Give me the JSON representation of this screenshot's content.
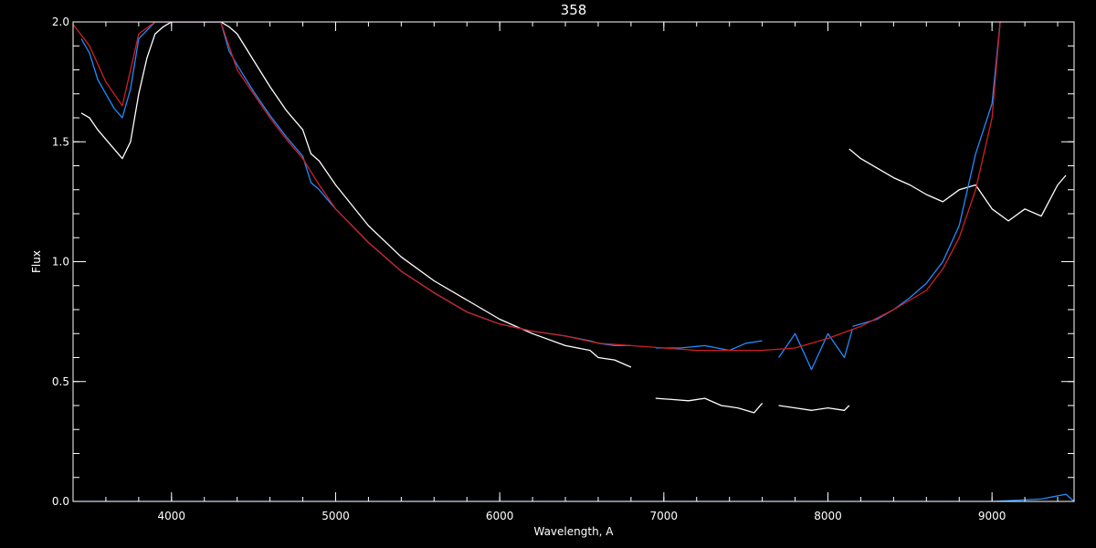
{
  "chart_data": {
    "type": "line",
    "title": "358",
    "xlabel": "Wavelength, A",
    "ylabel": "Flux",
    "xlim": [
      3400,
      9500
    ],
    "ylim": [
      0.0,
      2.0
    ],
    "x_ticks": [
      4000,
      5000,
      6000,
      7000,
      8000,
      9000
    ],
    "x_tick_labels": [
      "4000",
      "5000",
      "6000",
      "7000",
      "8000",
      "9000"
    ],
    "y_ticks": [
      0.0,
      0.5,
      1.0,
      1.5,
      2.0
    ],
    "y_tick_labels": [
      "0.0",
      "0.5",
      "1.0",
      "1.5",
      "2.0"
    ],
    "x_minor_step": 200,
    "y_minor_step": 0.1,
    "grid": false,
    "colors": {
      "background": "#000000",
      "axes": "#ffffff",
      "white_spectrum": "#ffffff",
      "blue_spectrum": "#1e8cff",
      "red_model": "#d02020"
    },
    "series": [
      {
        "color": "#ffffff",
        "segments": [
          {
            "x": [
              3450,
              3500,
              3550,
              3600,
              3650,
              3700,
              3750,
              3800,
              3850,
              3900,
              3950,
              4000,
              4100,
              4200,
              4300,
              4350,
              4400,
              4500,
              4600,
              4700,
              4800,
              4850,
              4900,
              5000,
              5200,
              5400,
              5600,
              5800,
              6000,
              6200,
              6400,
              6550,
              6600,
              6700,
              6800
            ],
            "y": [
              1.62,
              1.6,
              1.55,
              1.51,
              1.47,
              1.43,
              1.5,
              1.7,
              1.85,
              1.95,
              1.98,
              2.0,
              2.0,
              2.0,
              2.0,
              1.98,
              1.95,
              1.84,
              1.73,
              1.63,
              1.55,
              1.45,
              1.42,
              1.32,
              1.15,
              1.02,
              0.92,
              0.84,
              0.76,
              0.7,
              0.65,
              0.63,
              0.6,
              0.59,
              0.56
            ]
          },
          {
            "x": [
              6950,
              7050,
              7150,
              7250,
              7350,
              7450,
              7550,
              7600
            ],
            "y": [
              0.43,
              0.425,
              0.42,
              0.43,
              0.4,
              0.39,
              0.37,
              0.41
            ]
          },
          {
            "x": [
              7700,
              7800,
              7900,
              8000,
              8100,
              8130
            ],
            "y": [
              0.4,
              0.39,
              0.38,
              0.39,
              0.38,
              0.4
            ]
          },
          {
            "x": [
              8130,
              8200,
              8300,
              8400,
              8500,
              8600,
              8700,
              8800,
              8900,
              9000,
              9100,
              9200,
              9300,
              9400,
              9450
            ],
            "y": [
              1.47,
              1.43,
              1.39,
              1.35,
              1.32,
              1.28,
              1.25,
              1.3,
              1.32,
              1.22,
              1.17,
              1.22,
              1.19,
              1.32,
              1.36
            ]
          }
        ]
      },
      {
        "color": "#1e8cff",
        "segments": [
          {
            "x": [
              3450,
              3500,
              3550,
              3600,
              3650,
              3700,
              3750,
              3800,
              3900,
              4000,
              4100,
              4200,
              4300,
              4350,
              4400,
              4500,
              4600,
              4700,
              4800,
              4850,
              4900,
              5000,
              5200,
              5400,
              5600,
              5800,
              6000,
              6200,
              6400,
              6550,
              6600,
              6700,
              6800
            ],
            "y": [
              1.93,
              1.87,
              1.76,
              1.7,
              1.64,
              1.6,
              1.72,
              1.93,
              2.0,
              2.0,
              2.0,
              2.0,
              2.0,
              1.88,
              1.82,
              1.71,
              1.61,
              1.52,
              1.44,
              1.33,
              1.3,
              1.22,
              1.08,
              0.96,
              0.87,
              0.79,
              0.74,
              0.71,
              0.69,
              0.67,
              0.66,
              0.65,
              0.65
            ]
          },
          {
            "x": [
              6950,
              7100,
              7250,
              7400,
              7500,
              7600
            ],
            "y": [
              0.64,
              0.64,
              0.65,
              0.63,
              0.66,
              0.67
            ]
          },
          {
            "x": [
              7700,
              7800,
              7900,
              8000,
              8100,
              8150
            ],
            "y": [
              0.6,
              0.7,
              0.55,
              0.7,
              0.6,
              0.72
            ]
          },
          {
            "x": [
              8150,
              8300,
              8400,
              8500,
              8600,
              8700,
              8800,
              8850,
              8900,
              9000,
              9050
            ],
            "y": [
              0.73,
              0.76,
              0.8,
              0.85,
              0.91,
              1.0,
              1.15,
              1.3,
              1.45,
              1.66,
              2.0
            ]
          },
          {
            "x": [
              3400,
              5000,
              6000,
              7000,
              8000,
              9000,
              9300,
              9450,
              9500
            ],
            "y": [
              0.0,
              0.0,
              0.0,
              0.0,
              0.0,
              0.0,
              0.01,
              0.03,
              0.0
            ]
          }
        ]
      },
      {
        "color": "#d02020",
        "segments": [
          {
            "x": [
              3400,
              3500,
              3600,
              3700,
              3800,
              3900,
              4000,
              4100,
              4200,
              4300,
              4400,
              4500,
              4600,
              4700,
              4800,
              4900,
              5000,
              5200,
              5400,
              5600,
              5800,
              6000,
              6200,
              6400,
              6600,
              6800,
              7000,
              7200,
              7400,
              7600,
              7800,
              8000,
              8200,
              8400,
              8600,
              8700,
              8800,
              8900,
              9000,
              9050
            ],
            "y": [
              1.99,
              1.9,
              1.75,
              1.65,
              1.95,
              2.0,
              2.0,
              2.0,
              2.0,
              2.0,
              1.8,
              1.7,
              1.6,
              1.51,
              1.43,
              1.32,
              1.22,
              1.08,
              0.96,
              0.87,
              0.79,
              0.74,
              0.71,
              0.69,
              0.66,
              0.65,
              0.64,
              0.63,
              0.63,
              0.63,
              0.64,
              0.68,
              0.73,
              0.8,
              0.88,
              0.97,
              1.1,
              1.3,
              1.6,
              2.0
            ]
          }
        ]
      }
    ]
  }
}
